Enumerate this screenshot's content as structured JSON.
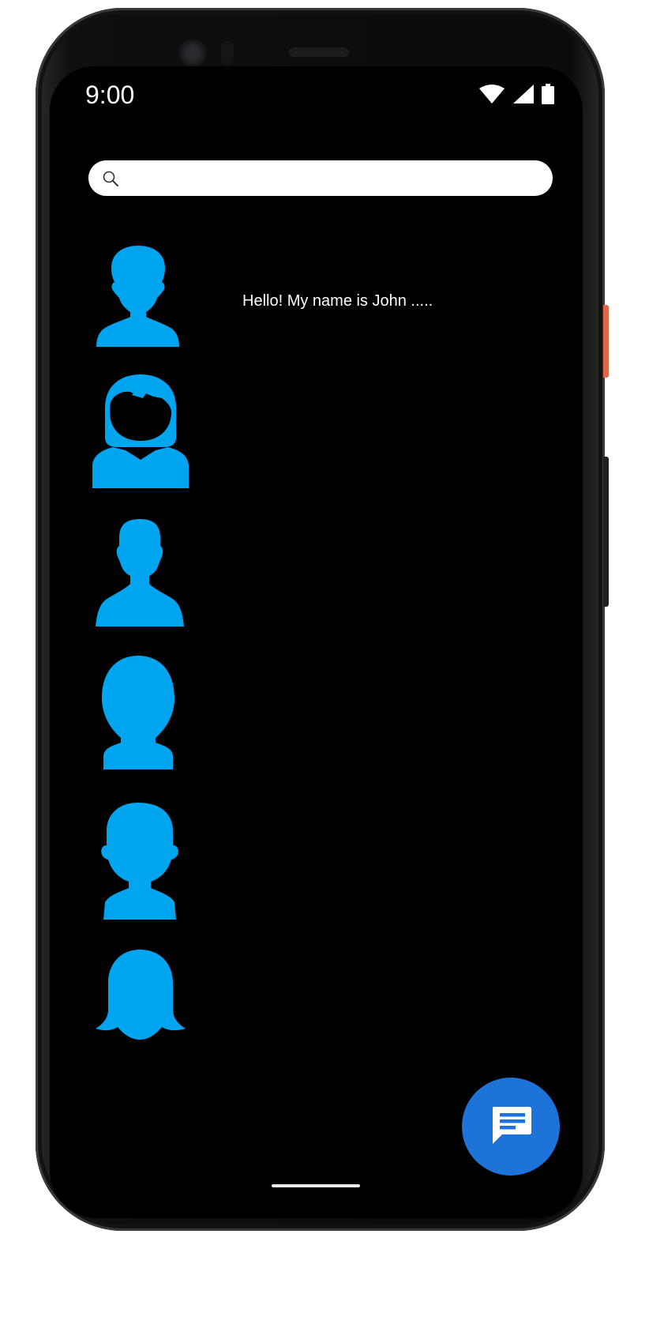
{
  "status_bar": {
    "time": "9:00",
    "icons": [
      "wifi-icon",
      "signal-icon",
      "battery-icon"
    ]
  },
  "search": {
    "value": "",
    "placeholder": ""
  },
  "contacts": [
    {
      "avatar": "male-avatar-icon",
      "message": "Hello! My name is John ....."
    },
    {
      "avatar": "female-avatar-icon",
      "message": ""
    },
    {
      "avatar": "male-avatar-icon",
      "message": ""
    },
    {
      "avatar": "bald-avatar-icon",
      "message": ""
    },
    {
      "avatar": "male-avatar-icon",
      "message": ""
    },
    {
      "avatar": "female-avatar-icon",
      "message": ""
    }
  ],
  "fab": {
    "icon": "chat-icon"
  },
  "colors": {
    "avatar": "#00a5f0",
    "fab": "#1d73d8",
    "screen_background": "#000000"
  }
}
